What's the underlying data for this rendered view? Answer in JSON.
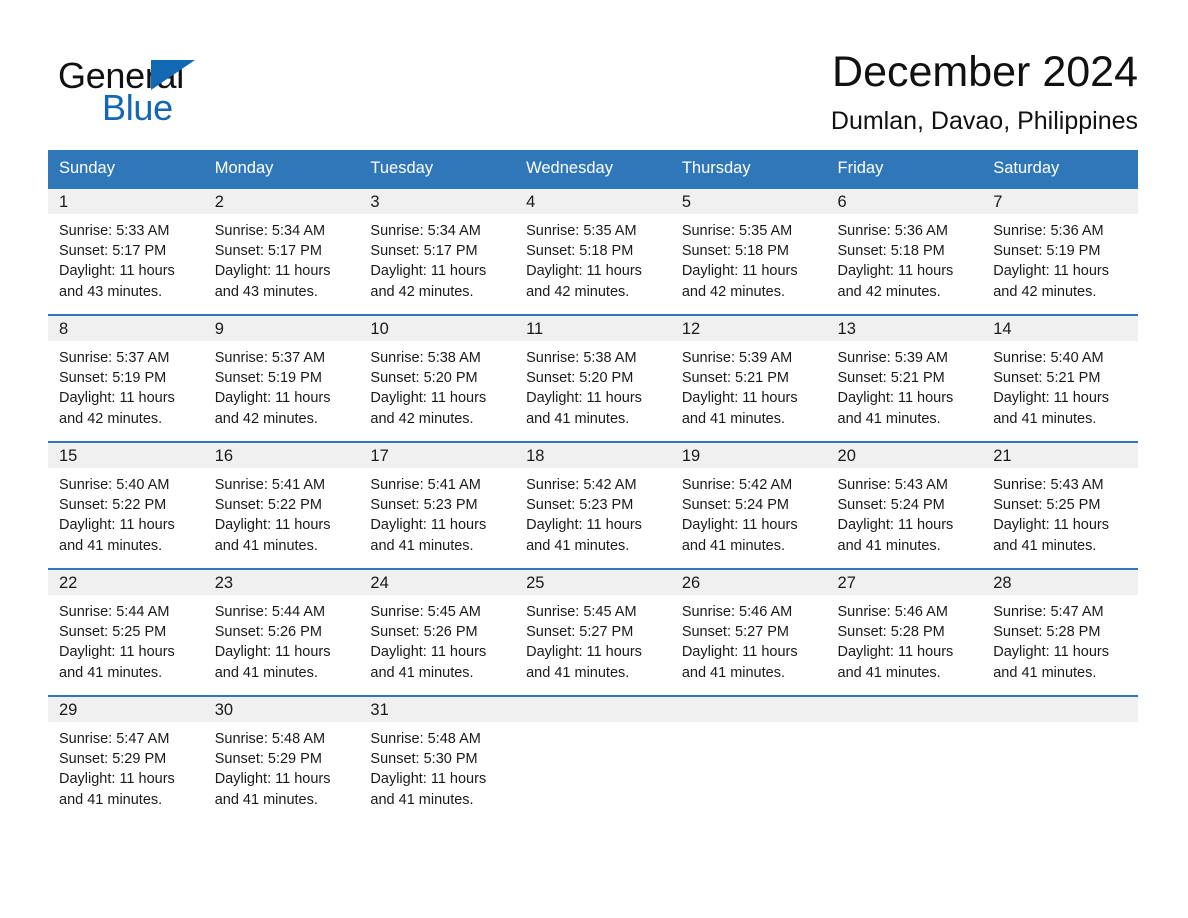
{
  "brand": {
    "name_dark": "General",
    "name_blue": "Blue",
    "triangle_icon": "triangle-icon",
    "accent_color": "#1268b3"
  },
  "header": {
    "title": "December 2024",
    "location": "Dumlan, Davao, Philippines"
  },
  "colors": {
    "header_blue": "#2f77b8",
    "row_border_blue": "#2f77b8",
    "daynum_band": "#f0f0f0",
    "text": "#1a1a1a"
  },
  "labels": {
    "sunrise_prefix": "Sunrise:",
    "sunset_prefix": "Sunset:",
    "daylight_prefix": "Daylight:"
  },
  "weekday_headers": [
    "Sunday",
    "Monday",
    "Tuesday",
    "Wednesday",
    "Thursday",
    "Friday",
    "Saturday"
  ],
  "weeks": [
    [
      {
        "day": "1",
        "sunrise": "Sunrise: 5:33 AM",
        "sunset": "Sunset: 5:17 PM",
        "daylight_l1": "Daylight: 11 hours",
        "daylight_l2": "and 43 minutes."
      },
      {
        "day": "2",
        "sunrise": "Sunrise: 5:34 AM",
        "sunset": "Sunset: 5:17 PM",
        "daylight_l1": "Daylight: 11 hours",
        "daylight_l2": "and 43 minutes."
      },
      {
        "day": "3",
        "sunrise": "Sunrise: 5:34 AM",
        "sunset": "Sunset: 5:17 PM",
        "daylight_l1": "Daylight: 11 hours",
        "daylight_l2": "and 42 minutes."
      },
      {
        "day": "4",
        "sunrise": "Sunrise: 5:35 AM",
        "sunset": "Sunset: 5:18 PM",
        "daylight_l1": "Daylight: 11 hours",
        "daylight_l2": "and 42 minutes."
      },
      {
        "day": "5",
        "sunrise": "Sunrise: 5:35 AM",
        "sunset": "Sunset: 5:18 PM",
        "daylight_l1": "Daylight: 11 hours",
        "daylight_l2": "and 42 minutes."
      },
      {
        "day": "6",
        "sunrise": "Sunrise: 5:36 AM",
        "sunset": "Sunset: 5:18 PM",
        "daylight_l1": "Daylight: 11 hours",
        "daylight_l2": "and 42 minutes."
      },
      {
        "day": "7",
        "sunrise": "Sunrise: 5:36 AM",
        "sunset": "Sunset: 5:19 PM",
        "daylight_l1": "Daylight: 11 hours",
        "daylight_l2": "and 42 minutes."
      }
    ],
    [
      {
        "day": "8",
        "sunrise": "Sunrise: 5:37 AM",
        "sunset": "Sunset: 5:19 PM",
        "daylight_l1": "Daylight: 11 hours",
        "daylight_l2": "and 42 minutes."
      },
      {
        "day": "9",
        "sunrise": "Sunrise: 5:37 AM",
        "sunset": "Sunset: 5:19 PM",
        "daylight_l1": "Daylight: 11 hours",
        "daylight_l2": "and 42 minutes."
      },
      {
        "day": "10",
        "sunrise": "Sunrise: 5:38 AM",
        "sunset": "Sunset: 5:20 PM",
        "daylight_l1": "Daylight: 11 hours",
        "daylight_l2": "and 42 minutes."
      },
      {
        "day": "11",
        "sunrise": "Sunrise: 5:38 AM",
        "sunset": "Sunset: 5:20 PM",
        "daylight_l1": "Daylight: 11 hours",
        "daylight_l2": "and 41 minutes."
      },
      {
        "day": "12",
        "sunrise": "Sunrise: 5:39 AM",
        "sunset": "Sunset: 5:21 PM",
        "daylight_l1": "Daylight: 11 hours",
        "daylight_l2": "and 41 minutes."
      },
      {
        "day": "13",
        "sunrise": "Sunrise: 5:39 AM",
        "sunset": "Sunset: 5:21 PM",
        "daylight_l1": "Daylight: 11 hours",
        "daylight_l2": "and 41 minutes."
      },
      {
        "day": "14",
        "sunrise": "Sunrise: 5:40 AM",
        "sunset": "Sunset: 5:21 PM",
        "daylight_l1": "Daylight: 11 hours",
        "daylight_l2": "and 41 minutes."
      }
    ],
    [
      {
        "day": "15",
        "sunrise": "Sunrise: 5:40 AM",
        "sunset": "Sunset: 5:22 PM",
        "daylight_l1": "Daylight: 11 hours",
        "daylight_l2": "and 41 minutes."
      },
      {
        "day": "16",
        "sunrise": "Sunrise: 5:41 AM",
        "sunset": "Sunset: 5:22 PM",
        "daylight_l1": "Daylight: 11 hours",
        "daylight_l2": "and 41 minutes."
      },
      {
        "day": "17",
        "sunrise": "Sunrise: 5:41 AM",
        "sunset": "Sunset: 5:23 PM",
        "daylight_l1": "Daylight: 11 hours",
        "daylight_l2": "and 41 minutes."
      },
      {
        "day": "18",
        "sunrise": "Sunrise: 5:42 AM",
        "sunset": "Sunset: 5:23 PM",
        "daylight_l1": "Daylight: 11 hours",
        "daylight_l2": "and 41 minutes."
      },
      {
        "day": "19",
        "sunrise": "Sunrise: 5:42 AM",
        "sunset": "Sunset: 5:24 PM",
        "daylight_l1": "Daylight: 11 hours",
        "daylight_l2": "and 41 minutes."
      },
      {
        "day": "20",
        "sunrise": "Sunrise: 5:43 AM",
        "sunset": "Sunset: 5:24 PM",
        "daylight_l1": "Daylight: 11 hours",
        "daylight_l2": "and 41 minutes."
      },
      {
        "day": "21",
        "sunrise": "Sunrise: 5:43 AM",
        "sunset": "Sunset: 5:25 PM",
        "daylight_l1": "Daylight: 11 hours",
        "daylight_l2": "and 41 minutes."
      }
    ],
    [
      {
        "day": "22",
        "sunrise": "Sunrise: 5:44 AM",
        "sunset": "Sunset: 5:25 PM",
        "daylight_l1": "Daylight: 11 hours",
        "daylight_l2": "and 41 minutes."
      },
      {
        "day": "23",
        "sunrise": "Sunrise: 5:44 AM",
        "sunset": "Sunset: 5:26 PM",
        "daylight_l1": "Daylight: 11 hours",
        "daylight_l2": "and 41 minutes."
      },
      {
        "day": "24",
        "sunrise": "Sunrise: 5:45 AM",
        "sunset": "Sunset: 5:26 PM",
        "daylight_l1": "Daylight: 11 hours",
        "daylight_l2": "and 41 minutes."
      },
      {
        "day": "25",
        "sunrise": "Sunrise: 5:45 AM",
        "sunset": "Sunset: 5:27 PM",
        "daylight_l1": "Daylight: 11 hours",
        "daylight_l2": "and 41 minutes."
      },
      {
        "day": "26",
        "sunrise": "Sunrise: 5:46 AM",
        "sunset": "Sunset: 5:27 PM",
        "daylight_l1": "Daylight: 11 hours",
        "daylight_l2": "and 41 minutes."
      },
      {
        "day": "27",
        "sunrise": "Sunrise: 5:46 AM",
        "sunset": "Sunset: 5:28 PM",
        "daylight_l1": "Daylight: 11 hours",
        "daylight_l2": "and 41 minutes."
      },
      {
        "day": "28",
        "sunrise": "Sunrise: 5:47 AM",
        "sunset": "Sunset: 5:28 PM",
        "daylight_l1": "Daylight: 11 hours",
        "daylight_l2": "and 41 minutes."
      }
    ],
    [
      {
        "day": "29",
        "sunrise": "Sunrise: 5:47 AM",
        "sunset": "Sunset: 5:29 PM",
        "daylight_l1": "Daylight: 11 hours",
        "daylight_l2": "and 41 minutes."
      },
      {
        "day": "30",
        "sunrise": "Sunrise: 5:48 AM",
        "sunset": "Sunset: 5:29 PM",
        "daylight_l1": "Daylight: 11 hours",
        "daylight_l2": "and 41 minutes."
      },
      {
        "day": "31",
        "sunrise": "Sunrise: 5:48 AM",
        "sunset": "Sunset: 5:30 PM",
        "daylight_l1": "Daylight: 11 hours",
        "daylight_l2": "and 41 minutes."
      },
      {
        "day": "",
        "sunrise": "",
        "sunset": "",
        "daylight_l1": "",
        "daylight_l2": ""
      },
      {
        "day": "",
        "sunrise": "",
        "sunset": "",
        "daylight_l1": "",
        "daylight_l2": ""
      },
      {
        "day": "",
        "sunrise": "",
        "sunset": "",
        "daylight_l1": "",
        "daylight_l2": ""
      },
      {
        "day": "",
        "sunrise": "",
        "sunset": "",
        "daylight_l1": "",
        "daylight_l2": ""
      }
    ]
  ]
}
